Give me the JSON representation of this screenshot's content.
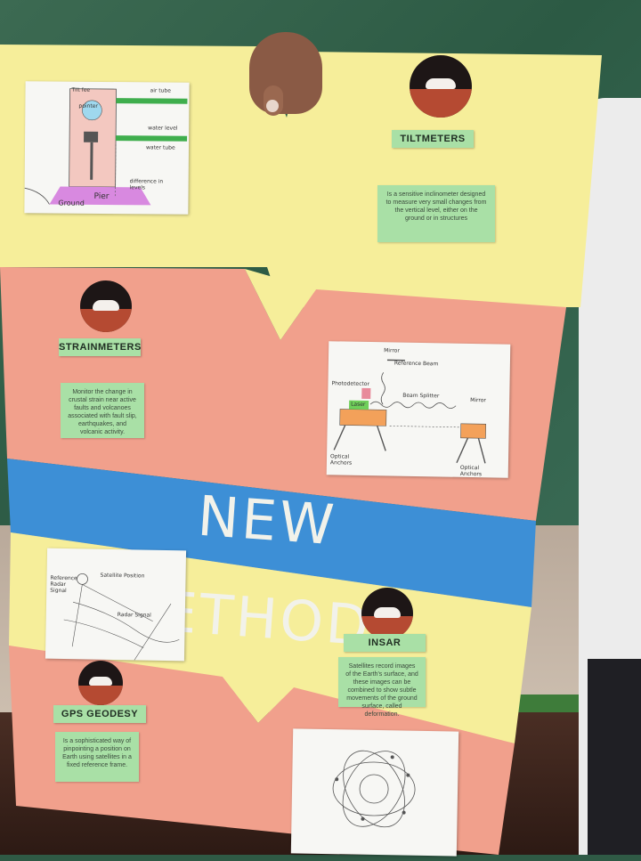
{
  "banner": {
    "title": "NEW METHODS"
  },
  "sections": [
    {
      "title": "TILTMETERS",
      "description": "Is a sensitive inclinometer designed to measure very small changes from the vertical level, either on the ground or in structures"
    },
    {
      "title": "STRAINMETERS",
      "description": "Monitor the change in crustal strain near active faults and volcanoes associated with fault slip, earthquakes, and volcanic activity."
    },
    {
      "title": "INSAR",
      "description": "Satellites record images of the Earth's surface, and these images can be combined to show subtle movements of the ground surface, called deformation."
    },
    {
      "title": "GPS GEODESY",
      "description": "Is a sophisticated way of pinpointing a position on Earth using satellites in a fixed reference frame."
    }
  ],
  "tiltmeter_sketch": {
    "labels": [
      "Tilt fee",
      "air tube",
      "pointer",
      "water level",
      "water tube",
      "Pier",
      "difference in levels",
      "Ground"
    ]
  },
  "strainmeter_sketch": {
    "labels": [
      "Mirror",
      "Reference Beam",
      "Photodetector",
      "Laser",
      "Beam Splitter",
      "Mirror",
      "Optical Anchors",
      "Optical Anchors"
    ]
  },
  "insar_sketch": {
    "labels": [
      "Reference Radar Signal",
      "Satellite Position",
      "Radar Signal"
    ]
  },
  "colors": {
    "yellow": "#f6ee9a",
    "salmon": "#f1a08c",
    "blue": "#3d8fd6",
    "label_green": "#a9e0a6"
  }
}
